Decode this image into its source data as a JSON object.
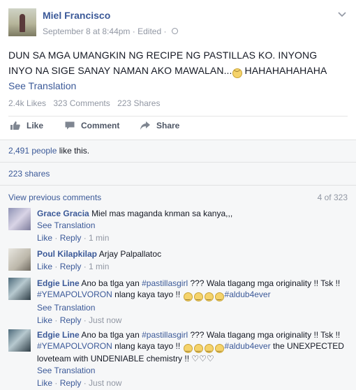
{
  "post": {
    "author": "Miel Francisco",
    "date": "September 8 at 8:44pm",
    "edited": "Edited",
    "text_before_emoji": "DUN SA MGA UMANGKIN NG RECIPE NG PASTILLAS KO. INYONG INYO NA SIGE SANAY NAMAN AKO MAWALAN...",
    "text_after_emoji": " HAHAHAHAHAHA",
    "see_translation": "See Translation",
    "stats": {
      "likes": "2.4k Likes",
      "comments": "323 Comments",
      "shares": "223 Shares"
    },
    "actions": {
      "like": "Like",
      "comment": "Comment",
      "share": "Share"
    }
  },
  "ufi": {
    "likes_count": "2,491 people",
    "likes_suffix": " like this.",
    "shares": "223 shares",
    "view_previous": "View previous comments",
    "count": "4 of 323"
  },
  "comments": [
    {
      "name": "Grace Gracia",
      "text": "Miel mas maganda knman sa kanya,,,",
      "see_translation": "See Translation",
      "like": "Like",
      "reply": "Reply",
      "time": "1 min"
    },
    {
      "name": "Poul Kilapkilap",
      "text": "Arjay Palpallatoc",
      "like": "Like",
      "reply": "Reply",
      "time": "1 min"
    },
    {
      "name": "Edgie Line",
      "text_1": "Ano ba tlga yan ",
      "hashtag_1": "#pastillasgirl",
      "text_2": " ??? Wala tlagang mga originality !! Tsk !! ",
      "hashtag_2": "#YEMAPOLVORON",
      "text_3": " nlang kaya tayo !! ",
      "hashtag_3": "#aldub4ever",
      "see_translation": "See Translation",
      "like": "Like",
      "reply": "Reply",
      "time": "Just now"
    },
    {
      "name": "Edgie Line",
      "text_1": "Ano ba tlga yan ",
      "hashtag_1": "#pastillasgirl",
      "text_2": " ??? Wala tlagang mga originality !! Tsk !! ",
      "hashtag_2": "#YEMAPOLVORON",
      "text_3": " nlang kaya tayo !! ",
      "hashtag_3": "#aldub4ever",
      "text_4": " the UNEXPECTED loveteam with UNDENIABLE chemistry !! ♡♡♡",
      "see_translation": "See Translation",
      "like": "Like",
      "reply": "Reply",
      "time": "Just now"
    }
  ],
  "colors": {
    "link": "#3b5998",
    "meta": "#9197a3",
    "text": "#141823",
    "ufi_bg": "#f6f7f8"
  },
  "icons": {
    "like": "thumbs-up-icon",
    "comment": "comment-bubble-icon",
    "share": "share-arrow-icon",
    "privacy": "globe-icon",
    "menu": "chevron-down-icon",
    "emoji_sad": "sad-face-emoji",
    "emoji_smile": "smiley-emoji"
  }
}
